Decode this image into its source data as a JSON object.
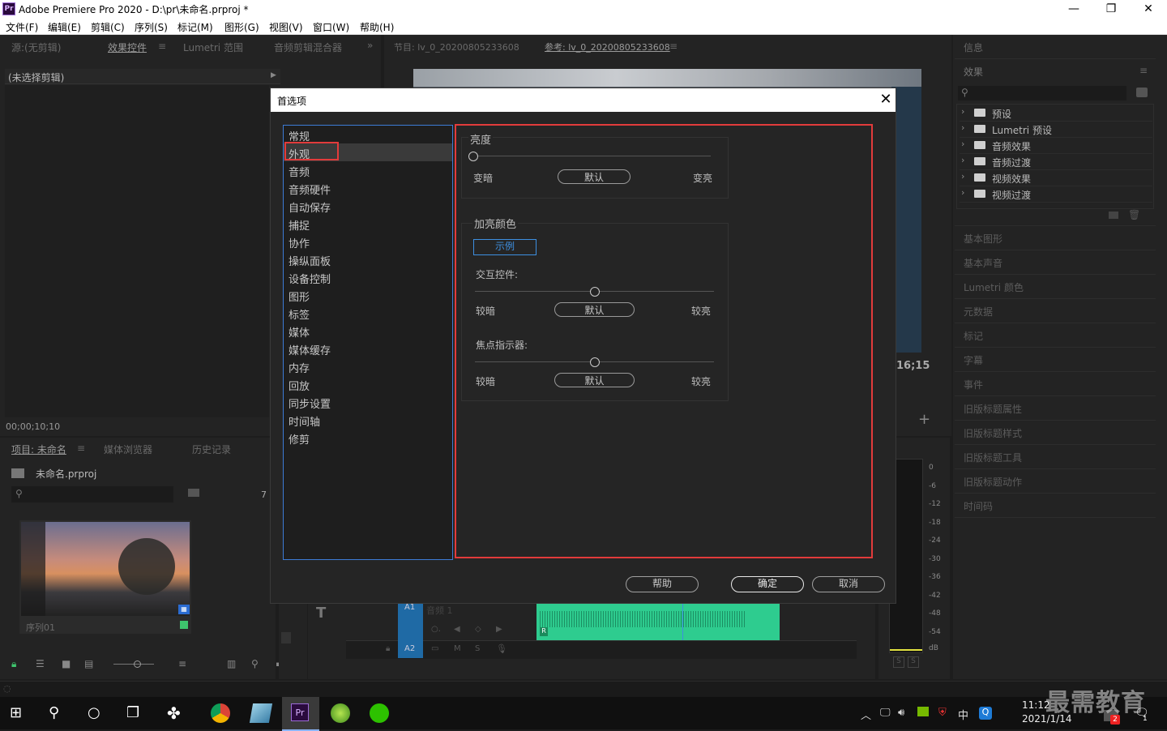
{
  "window": {
    "title": "Adobe Premiere Pro 2020 - D:\\pr\\未命名.prproj *",
    "icon_label": "Pr",
    "controls": {
      "minimize": "—",
      "maximize": "❐",
      "close": "✕"
    }
  },
  "menu": [
    "文件(F)",
    "编辑(E)",
    "剪辑(C)",
    "序列(S)",
    "标记(M)",
    "图形(G)",
    "视图(V)",
    "窗口(W)",
    "帮助(H)"
  ],
  "source_panel": {
    "tabs": [
      "源:(无剪辑)",
      "效果控件",
      "Lumetri 范围",
      "音频剪辑混合器"
    ],
    "overflow": "»",
    "no_clip": "(未选择剪辑)",
    "timecode": "00;00;10;10"
  },
  "program_panel": {
    "tabs": [
      "节目: lv_0_20200805233608",
      "参考: lv_0_20200805233608"
    ],
    "timecode_partial": "16;15"
  },
  "project_panel": {
    "tabs": [
      "项目: 未命名",
      "媒体浏览器",
      "历史记录"
    ],
    "project_file": "未命名.prproj",
    "item_count": "7",
    "thumb_label": "序列01"
  },
  "timeline": {
    "track_a1": "A1",
    "track_a2": "A2",
    "audio_name": "音频 1",
    "mute": "M",
    "solo": "S",
    "r_badge": "R"
  },
  "meter": {
    "labels": [
      "0",
      "-6",
      "-12",
      "-18",
      "-24",
      "-30",
      "-36",
      "-42",
      "-48",
      "-54",
      "dB"
    ],
    "solo": [
      "S",
      "S"
    ]
  },
  "right_panel": {
    "info_title": "信息",
    "effects_title": "效果",
    "effects_items": [
      "预设",
      "Lumetri 预设",
      "音频效果",
      "音频过渡",
      "视频效果",
      "视频过渡"
    ],
    "other_panels": [
      "基本图形",
      "基本声音",
      "Lumetri 颜色",
      "元数据",
      "标记",
      "字幕",
      "事件",
      "旧版标题属性",
      "旧版标题样式",
      "旧版标题工具",
      "旧版标题动作",
      "时间码"
    ]
  },
  "dialog": {
    "title": "首选项",
    "close": "✕",
    "categories": [
      "常规",
      "外观",
      "音频",
      "音频硬件",
      "自动保存",
      "捕捉",
      "协作",
      "操纵面板",
      "设备控制",
      "图形",
      "标签",
      "媒体",
      "媒体缓存",
      "内存",
      "回放",
      "同步设置",
      "时间轴",
      "修剪"
    ],
    "selected_index": 1,
    "brightness": {
      "label": "亮度",
      "value": 0.0,
      "left": "变暗",
      "default": "默认",
      "right": "变亮"
    },
    "highlight": {
      "label": "加亮颜色",
      "sample": "示例",
      "interactive": {
        "label": "交互控件:",
        "value": 0.5,
        "left": "较暗",
        "default": "默认",
        "right": "较亮"
      },
      "focus": {
        "label": "焦点指示器:",
        "value": 0.5,
        "left": "较暗",
        "default": "默认",
        "right": "较亮"
      }
    },
    "buttons": {
      "help": "帮助",
      "ok": "确定",
      "cancel": "取消"
    }
  },
  "taskbar": {
    "time": "11:12",
    "date": "2021/1/14",
    "ime": "中",
    "notif_count": "2",
    "msg_count": "1"
  },
  "watermark": "最需教育",
  "colors": {
    "accent_blue": "#3d8fe0",
    "highlight_red": "#e23b3b",
    "audio_green": "#2ecc8f"
  }
}
